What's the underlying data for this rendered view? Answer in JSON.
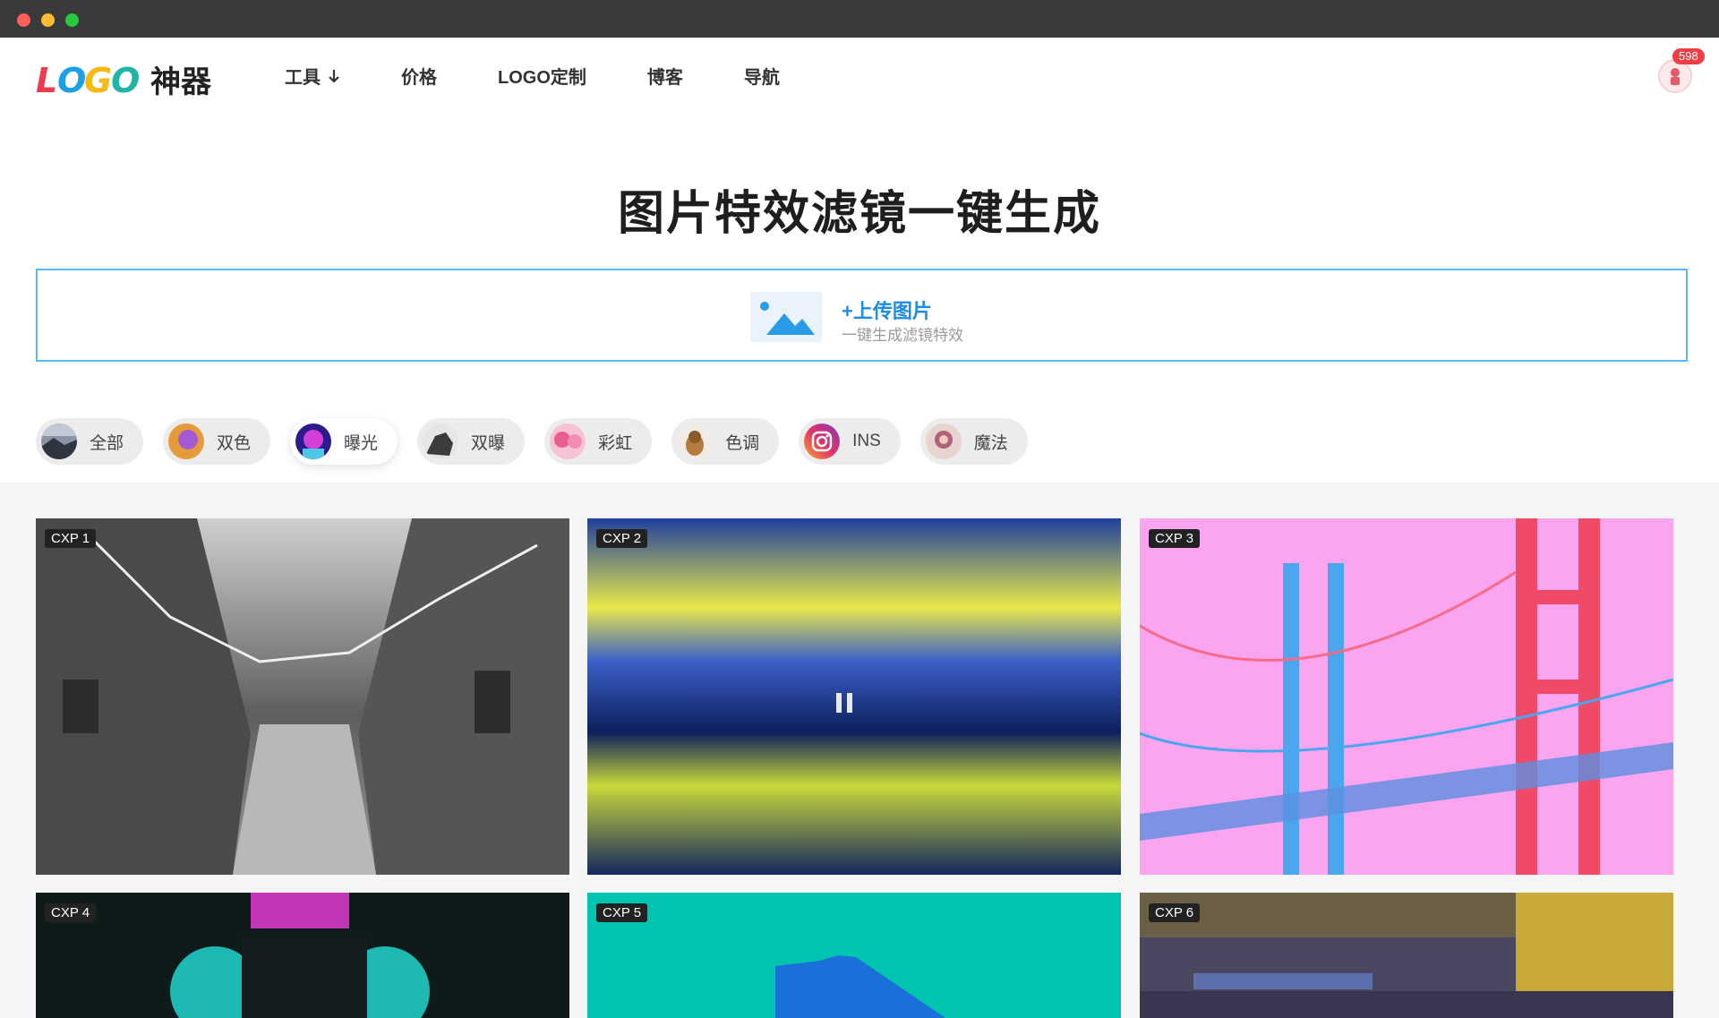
{
  "window": {
    "traffic_lights": [
      "close",
      "minimize",
      "zoom"
    ]
  },
  "header": {
    "logo_text": "LOGO神器",
    "nav": [
      {
        "label": "工具",
        "has_dropdown": true
      },
      {
        "label": "价格"
      },
      {
        "label": "LOGO定制"
      },
      {
        "label": "博客"
      },
      {
        "label": "导航"
      }
    ],
    "notification_count": "598"
  },
  "main": {
    "title": "图片特效滤镜一键生成",
    "upload": {
      "title": "+上传图片",
      "subtitle": "一键生成滤镜特效"
    }
  },
  "filters": [
    {
      "label": "全部",
      "active": false
    },
    {
      "label": "双色",
      "active": false
    },
    {
      "label": "曝光",
      "active": true
    },
    {
      "label": "双曝",
      "active": false
    },
    {
      "label": "彩虹",
      "active": false
    },
    {
      "label": "色调",
      "active": false
    },
    {
      "label": "INS",
      "active": false
    },
    {
      "label": "魔法",
      "active": false
    }
  ],
  "gallery": [
    {
      "tag": "CXP 1"
    },
    {
      "tag": "CXP 2"
    },
    {
      "tag": "CXP 3"
    },
    {
      "tag": "CXP 4"
    },
    {
      "tag": "CXP 5"
    },
    {
      "tag": "CXP 6"
    }
  ],
  "colors": {
    "accent": "#1d8de4",
    "upload_border": "#58b9ee",
    "badge": "#ef3e45"
  }
}
